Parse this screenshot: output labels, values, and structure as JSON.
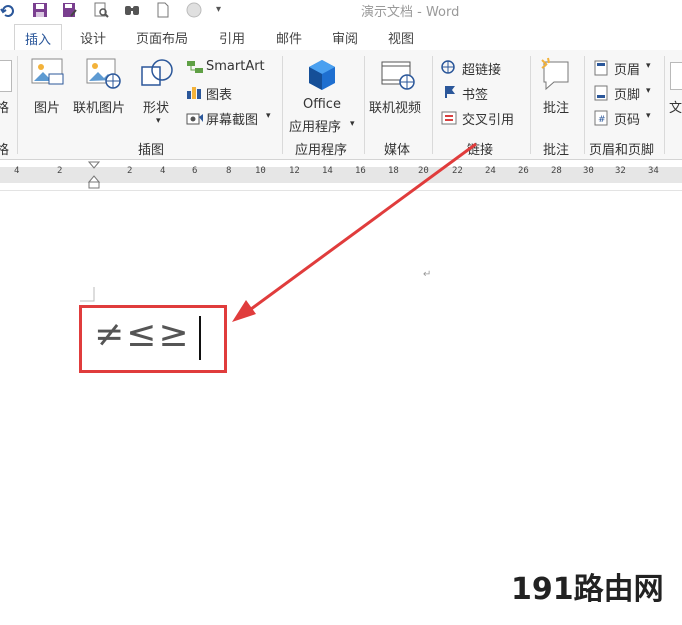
{
  "window": {
    "title": "演示文档 - Word"
  },
  "tabs": [
    "插入",
    "设计",
    "页面布局",
    "引用",
    "邮件",
    "审阅",
    "视图"
  ],
  "active_tab": "插入",
  "ribbon": {
    "left_partial": {
      "label": "格",
      "group": "格"
    },
    "illustrations": {
      "picture": "图片",
      "online_picture": "联机图片",
      "shapes": "形状",
      "smartart": "SmartArt",
      "chart": "图表",
      "screenshot": "屏幕截图",
      "group_label": "插图"
    },
    "apps": {
      "office_line1": "Office",
      "office_line2": "应用程序",
      "group_label": "应用程序"
    },
    "media": {
      "online_video": "联机视频",
      "group_label": "媒体"
    },
    "links": {
      "hyperlink": "超链接",
      "bookmark": "书签",
      "cross_reference": "交叉引用",
      "group_label": "链接"
    },
    "comments": {
      "comment": "批注",
      "group_label": "批注"
    },
    "header_footer": {
      "header": "页眉",
      "footer": "页脚",
      "page_number": "页码",
      "group_label": "页眉和页脚"
    },
    "right_partial": "文"
  },
  "ruler": {
    "ticks": [
      "4",
      "2",
      "2",
      "4",
      "6",
      "8",
      "10",
      "12",
      "14",
      "16",
      "18",
      "20",
      "22",
      "24",
      "26",
      "28",
      "30",
      "32",
      "34"
    ]
  },
  "document": {
    "content": "≠≤≥",
    "highlight_color": "#e03c3c"
  },
  "watermark": {
    "text": "191路由网"
  },
  "colors": {
    "accent": "#2b579a",
    "arrow": "#e03c3c"
  }
}
